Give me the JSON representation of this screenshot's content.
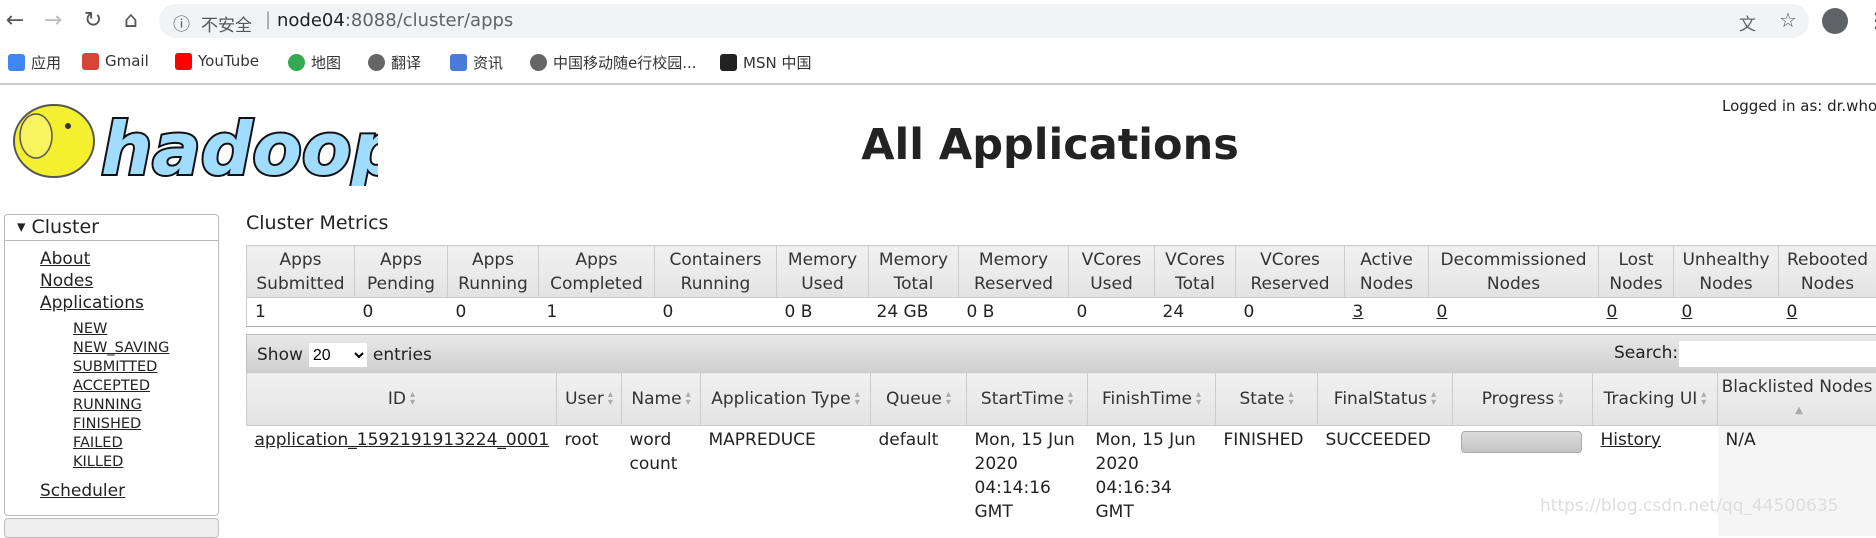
{
  "browser": {
    "security": "不安全",
    "url_host": "node04",
    "url_rest": ":8088/cluster/apps",
    "bookmarks": [
      {
        "label": "应用",
        "icon": "apps-grid-icon"
      },
      {
        "label": "Gmail",
        "icon": "gmail-icon"
      },
      {
        "label": "YouTube",
        "icon": "youtube-icon"
      },
      {
        "label": "地图",
        "icon": "maps-icon"
      },
      {
        "label": "翻译",
        "icon": "globe-icon"
      },
      {
        "label": "资讯",
        "icon": "news-icon"
      },
      {
        "label": "中国移动随e行校园...",
        "icon": "globe-icon"
      },
      {
        "label": "MSN 中国",
        "icon": "msn-icon"
      }
    ]
  },
  "header": {
    "title": "All Applications",
    "logged_in": "Logged in as: dr.who",
    "logo": "hadoop"
  },
  "sidebar": {
    "section": "Cluster",
    "links": [
      "About",
      "Nodes",
      "Applications"
    ],
    "states": [
      "NEW",
      "NEW_SAVING",
      "SUBMITTED",
      "ACCEPTED",
      "RUNNING",
      "FINISHED",
      "FAILED",
      "KILLED"
    ],
    "scheduler": "Scheduler"
  },
  "metrics": {
    "title": "Cluster Metrics",
    "headers": [
      "Apps Submitted",
      "Apps Pending",
      "Apps Running",
      "Apps Completed",
      "Containers Running",
      "Memory Used",
      "Memory Total",
      "Memory Reserved",
      "VCores Used",
      "VCores Total",
      "VCores Reserved",
      "Active Nodes",
      "Decommissioned Nodes",
      "Lost Nodes",
      "Unhealthy Nodes",
      "Rebooted Nodes"
    ],
    "values": [
      "1",
      "0",
      "0",
      "1",
      "0",
      "0 B",
      "24 GB",
      "0 B",
      "0",
      "24",
      "0",
      "3",
      "0",
      "0",
      "0",
      "0"
    ],
    "links": [
      11,
      12,
      13,
      14,
      15
    ]
  },
  "toolbar": {
    "show": "Show",
    "entries_value": "20",
    "entries": "entries",
    "search": "Search:",
    "search_value": ""
  },
  "apps": {
    "headers": [
      "ID",
      "User",
      "Name",
      "Application Type",
      "Queue",
      "StartTime",
      "FinishTime",
      "State",
      "FinalStatus",
      "Progress",
      "Tracking UI",
      "Blacklisted Nodes"
    ],
    "rows": [
      {
        "id": "application_1592191913224_0001",
        "user": "root",
        "name": "word count",
        "type": "MAPREDUCE",
        "queue": "default",
        "start": "Mon, 15 Jun 2020 04:14:16 GMT",
        "finish": "Mon, 15 Jun 2020 04:16:34 GMT",
        "state": "FINISHED",
        "final": "SUCCEEDED",
        "progress": 100,
        "tracking": "History",
        "blacklisted": "N/A"
      }
    ]
  },
  "watermark": "https://blog.csdn.net/qq_44500635"
}
